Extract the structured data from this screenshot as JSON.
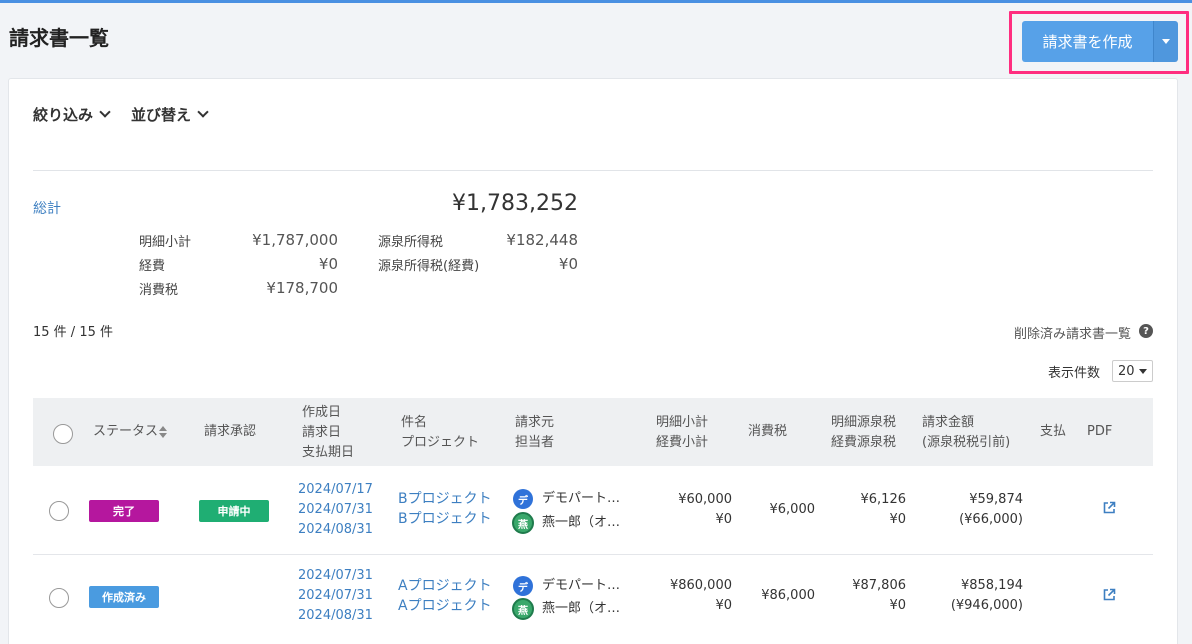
{
  "header": {
    "title": "請求書一覧",
    "create_label": "請求書を作成"
  },
  "toolbar": {
    "filter_label": "絞り込み",
    "sort_label": "並び替え"
  },
  "summary": {
    "total_label": "総計",
    "grand_total": "¥1,783,252",
    "items": [
      {
        "label": "明細小計",
        "value": "¥1,787,000"
      },
      {
        "label": "経費",
        "value": "¥0"
      },
      {
        "label": "消費税",
        "value": "¥178,700"
      },
      {
        "label": "源泉所得税",
        "value": "¥182,448"
      },
      {
        "label": "源泉所得税(経費)",
        "value": "¥0"
      }
    ]
  },
  "list": {
    "count": "15 件 / 15 件",
    "deleted_link": "削除済み請求書一覧",
    "per_page_label": "表示件数",
    "per_page_value": "20"
  },
  "table": {
    "headers": {
      "status": "ステータス",
      "approval": "請求承認",
      "dates": [
        "作成日",
        "請求日",
        "支払期日"
      ],
      "title": [
        "件名",
        "プロジェクト"
      ],
      "issuer": [
        "請求元",
        "担当者"
      ],
      "subtotal": [
        "明細小計",
        "経費小計"
      ],
      "tax": "消費税",
      "withholding": [
        "明細源泉税",
        "経費源泉税"
      ],
      "amount": [
        "請求金額",
        "(源泉税税引前)"
      ],
      "payment": "支払",
      "pdf": "PDF"
    },
    "rows": [
      {
        "status": "完了",
        "status_color": "#b5179e",
        "approval": "申請中",
        "approval_color": "#1fae73",
        "created": "2024/07/17",
        "billed": "2024/07/31",
        "due": "2024/08/31",
        "title": "Bプロジェクト",
        "project": "Bプロジェクト",
        "issuer_avatar": "デ",
        "issuer": "デモパート…",
        "person_avatar": "燕",
        "person": "燕一郎（オ…",
        "subtotal": "¥60,000",
        "expenses": "¥0",
        "tax": "¥6,000",
        "withholding": "¥6,126",
        "withholding_expenses": "¥0",
        "amount": "¥59,874",
        "amount_pre": "(¥66,000)"
      },
      {
        "status": "作成済み",
        "status_color": "#4a9be0",
        "approval": "",
        "approval_color": "",
        "created": "2024/07/31",
        "billed": "2024/07/31",
        "due": "2024/08/31",
        "title": "Aプロジェクト",
        "project": "Aプロジェクト",
        "issuer_avatar": "デ",
        "issuer": "デモパート…",
        "person_avatar": "燕",
        "person": "燕一郎（オ…",
        "subtotal": "¥860,000",
        "expenses": "¥0",
        "tax": "¥86,000",
        "withholding": "¥87,806",
        "withholding_expenses": "¥0",
        "amount": "¥858,194",
        "amount_pre": "(¥946,000)"
      }
    ]
  }
}
